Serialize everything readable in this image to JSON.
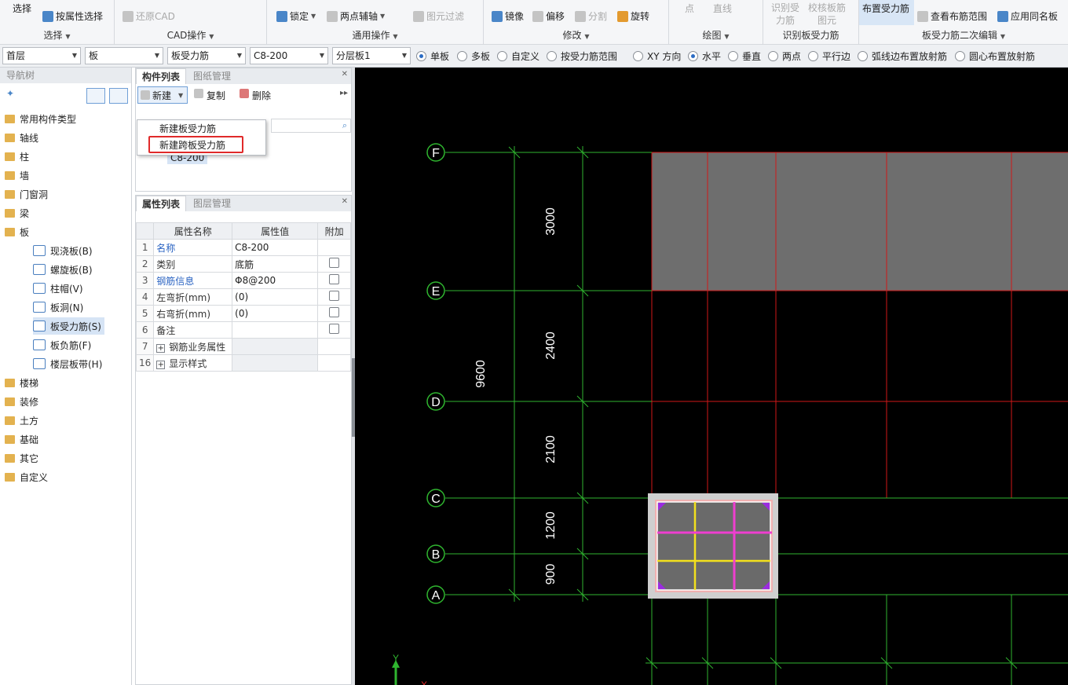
{
  "ribbon": {
    "groups": [
      {
        "title": "选择",
        "buttons": [
          "选择",
          "按属性选择"
        ]
      },
      {
        "title": "CAD操作",
        "buttons": [
          "还原CAD"
        ]
      },
      {
        "title": "通用操作",
        "buttons": [
          "锁定",
          "两点辅轴",
          "图元过滤"
        ]
      },
      {
        "title": "修改",
        "buttons": [
          "镜像",
          "偏移",
          "分割",
          "旋转"
        ]
      },
      {
        "title": "绘图",
        "buttons": [
          "点",
          "直线"
        ]
      },
      {
        "title": "识别板受力筋",
        "buttons": [
          "识别受力筋",
          "校核板筋图元"
        ]
      },
      {
        "title": "板受力筋二次编辑",
        "buttons": [
          "布置受力筋",
          "查看布筋范围",
          "应用同名板"
        ]
      }
    ]
  },
  "toolbar": {
    "floor": "首层",
    "category": "板",
    "type": "板受力筋",
    "component": "C8-200",
    "layer": "分层板1",
    "radio_group1": [
      {
        "label": "单板",
        "checked": true
      },
      {
        "label": "多板",
        "checked": false
      },
      {
        "label": "自定义",
        "checked": false
      },
      {
        "label": "按受力筋范围",
        "checked": false
      }
    ],
    "radio_group2": [
      {
        "label": "XY 方向",
        "checked": false
      },
      {
        "label": "水平",
        "checked": true
      },
      {
        "label": "垂直",
        "checked": false
      },
      {
        "label": "两点",
        "checked": false
      },
      {
        "label": "平行边",
        "checked": false
      },
      {
        "label": "弧线边布置放射筋",
        "checked": false
      },
      {
        "label": "圆心布置放射筋",
        "checked": false
      }
    ]
  },
  "nav": {
    "title": "导航树",
    "items": [
      {
        "label": "常用构件类型",
        "kind": "folder"
      },
      {
        "label": "轴线",
        "kind": "folder"
      },
      {
        "label": "柱",
        "kind": "folder"
      },
      {
        "label": "墙",
        "kind": "folder"
      },
      {
        "label": "门窗洞",
        "kind": "folder"
      },
      {
        "label": "梁",
        "kind": "folder"
      },
      {
        "label": "板",
        "kind": "folder-open"
      },
      {
        "label": "现浇板(B)",
        "kind": "child"
      },
      {
        "label": "螺旋板(B)",
        "kind": "child"
      },
      {
        "label": "柱帽(V)",
        "kind": "child"
      },
      {
        "label": "板洞(N)",
        "kind": "child"
      },
      {
        "label": "板受力筋(S)",
        "kind": "child-selected"
      },
      {
        "label": "板负筋(F)",
        "kind": "child"
      },
      {
        "label": "楼层板带(H)",
        "kind": "child"
      },
      {
        "label": "楼梯",
        "kind": "folder"
      },
      {
        "label": "装修",
        "kind": "folder"
      },
      {
        "label": "土方",
        "kind": "folder"
      },
      {
        "label": "基础",
        "kind": "folder"
      },
      {
        "label": "其它",
        "kind": "folder"
      },
      {
        "label": "自定义",
        "kind": "folder"
      }
    ]
  },
  "components": {
    "tab_active": "构件列表",
    "tab_inactive": "图纸管理",
    "new_label": "新建",
    "copy_label": "复制",
    "delete_label": "删除",
    "dropdown": [
      "新建板受力筋",
      "新建跨板受力筋"
    ],
    "list_item": "C8-200"
  },
  "properties": {
    "tab_active": "属性列表",
    "tab_inactive": "图层管理",
    "headers": [
      "属性名称",
      "属性值",
      "附加"
    ],
    "rows": [
      {
        "no": "1",
        "name": "名称",
        "value": "C8-200",
        "check": false
      },
      {
        "no": "2",
        "name": "类别",
        "value": "底筋",
        "check": true
      },
      {
        "no": "3",
        "name": "钢筋信息",
        "value": "Φ8@200",
        "check": true
      },
      {
        "no": "4",
        "name": "左弯折(mm)",
        "value": "(0)",
        "check": true
      },
      {
        "no": "5",
        "name": "右弯折(mm)",
        "value": "(0)",
        "check": true
      },
      {
        "no": "6",
        "name": "备注",
        "value": "",
        "check": true
      },
      {
        "no": "7",
        "name": "钢筋业务属性",
        "value": "",
        "check": false,
        "expand": true
      },
      {
        "no": "16",
        "name": "显示样式",
        "value": "",
        "check": false,
        "expand": true
      }
    ]
  },
  "drawing": {
    "axes": [
      "F",
      "E",
      "D",
      "C",
      "B",
      "A"
    ],
    "dims": [
      "3000",
      "2400",
      "2100",
      "1200",
      "900"
    ],
    "total": "9600",
    "y_label": "Y",
    "x_label": "X"
  }
}
